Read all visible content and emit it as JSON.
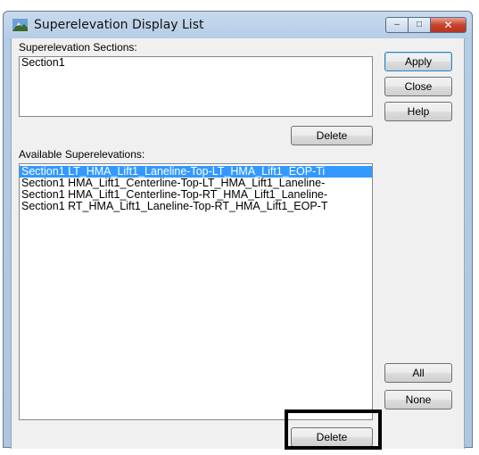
{
  "window": {
    "title": "Superelevation Display List",
    "controls": {
      "minimize": "–",
      "maximize": "□",
      "close": "✕"
    }
  },
  "sections": {
    "label": "Superelevation Sections:",
    "items": [
      "Section1"
    ],
    "delete_label": "Delete"
  },
  "available": {
    "label": "Available Superelevations:",
    "items": [
      "Section1 LT_HMA_Lift1_Laneline-Top-LT_HMA_Lift1_EOP-Ti",
      "Section1 HMA_Lift1_Centerline-Top-LT_HMA_Lift1_Laneline-",
      "Section1 HMA_Lift1_Centerline-Top-RT_HMA_Lift1_Laneline-",
      "Section1 RT_HMA_Lift1_Laneline-Top-RT_HMA_Lift1_EOP-T"
    ],
    "selected_index": 0,
    "delete_label": "Delete"
  },
  "buttons": {
    "apply": "Apply",
    "close": "Close",
    "help": "Help",
    "all": "All",
    "none": "None"
  },
  "colors": {
    "selection": "#3399ff",
    "highlight_box": "#000000"
  }
}
